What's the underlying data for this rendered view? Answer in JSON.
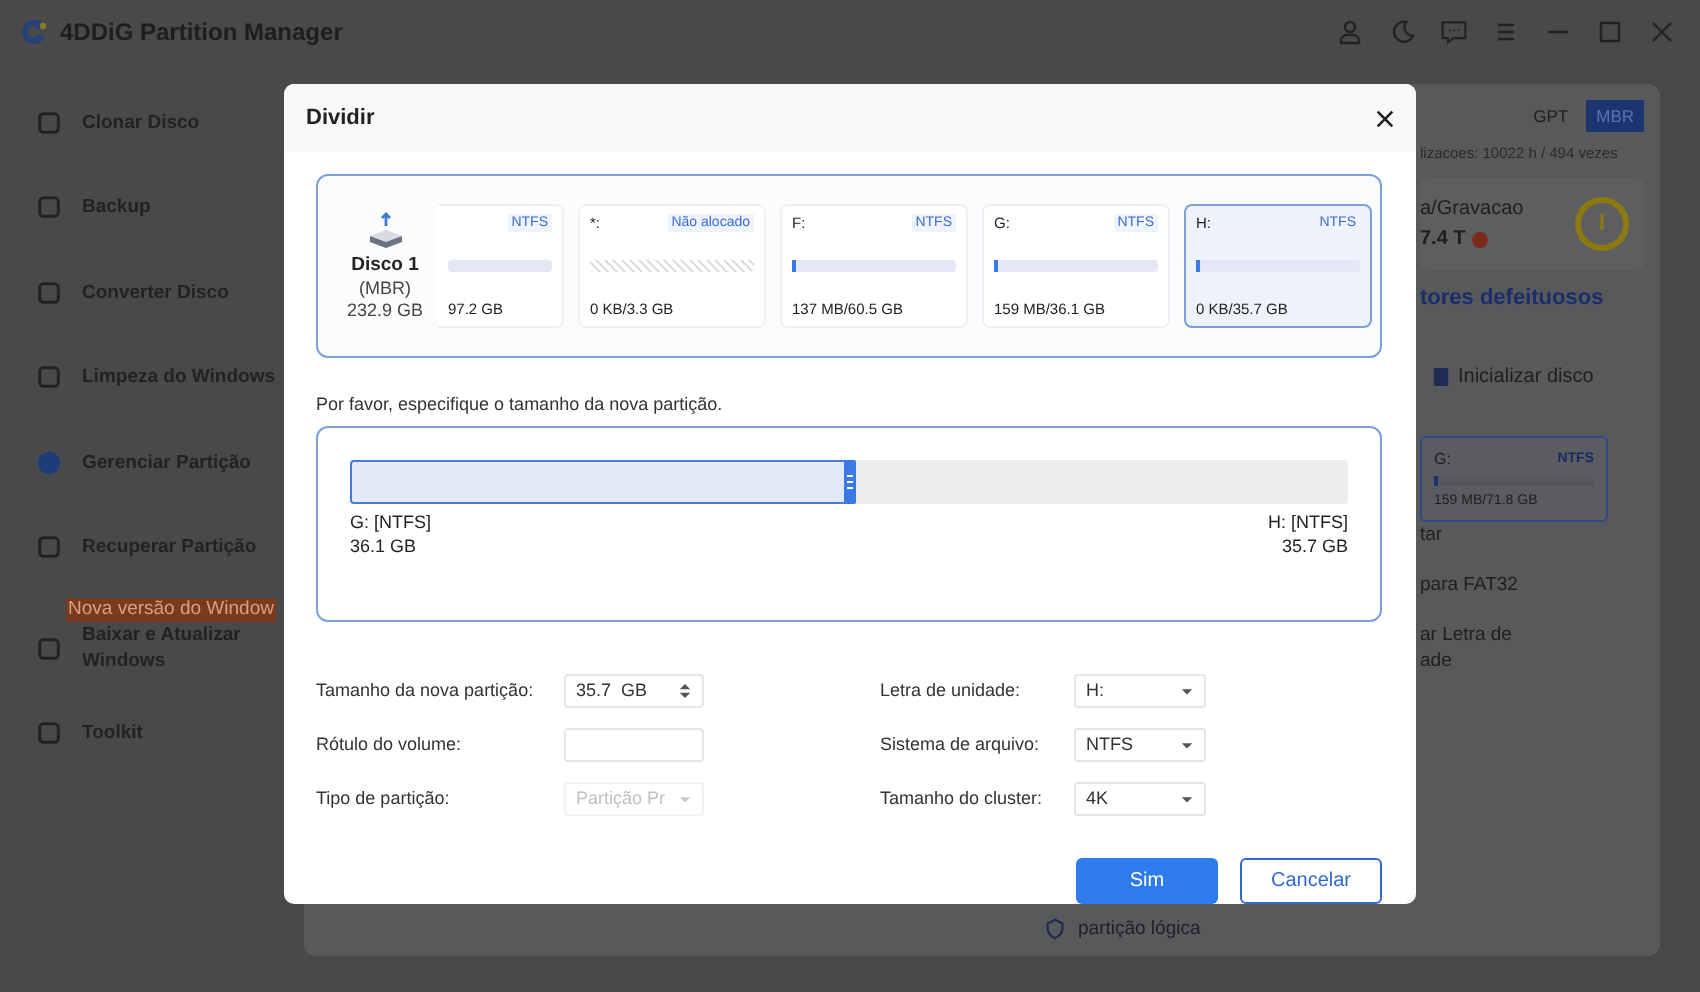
{
  "window": {
    "title": "4DDiG Partition Manager"
  },
  "sidebar": {
    "items": [
      {
        "label": "Clonar Disco",
        "selected": false
      },
      {
        "label": "Backup",
        "selected": false
      },
      {
        "label": "Converter Disco",
        "selected": false
      },
      {
        "label": "Limpeza do Windows",
        "selected": false
      },
      {
        "label": "Gerenciar Partição",
        "selected": true
      },
      {
        "label": "Recuperar Partição",
        "selected": false
      },
      {
        "label": "Baixar e Atualizar Windows",
        "selected": false,
        "badge": "Nova versão do Window"
      },
      {
        "label": "Toolkit",
        "selected": false
      }
    ]
  },
  "background_panel": {
    "style_tabs": [
      {
        "label": "GPT",
        "selected": false
      },
      {
        "label": "MBR",
        "selected": true
      }
    ],
    "usage": "lizacoes: 10022 h / 494 vezes",
    "rw_label": "a/Gravacao",
    "rw_value": "7.4 T",
    "link": "tores defeituosos",
    "init_action": "Inicializar disco",
    "partition": {
      "letter": "G:",
      "fs": "NTFS",
      "usage": "159 MB/71.8 GB",
      "level": 0.02
    },
    "actions": [
      "tar",
      "para FAT32",
      "ar Letra de\nade"
    ],
    "bottom_action": "partição lógica"
  },
  "dialog": {
    "title": "Dividir",
    "disk": {
      "name": "Disco 1",
      "style": "(MBR)",
      "size": "232.9 GB"
    },
    "partitions": [
      {
        "kind": "partition",
        "fs": "NTFS",
        "usage": "97.2 GB",
        "selected": false
      },
      {
        "kind": "unallocated",
        "letter": "*:",
        "fs": "Não alocado",
        "usage": "0 KB/3.3 GB",
        "selected": false
      },
      {
        "kind": "partition",
        "letter": "F:",
        "fs": "NTFS",
        "usage": "137 MB/60.5 GB",
        "level": 0.02,
        "selected": false
      },
      {
        "kind": "partition",
        "letter": "G:",
        "fs": "NTFS",
        "usage": "159 MB/36.1 GB",
        "level": 0.02,
        "selected": false
      },
      {
        "kind": "partition",
        "letter": "H:",
        "fs": "NTFS",
        "usage": "0 KB/35.7 GB",
        "level": 0.02,
        "selected": true
      }
    ],
    "prompt": "Por favor, especifique o tamanho da nova partição.",
    "split": {
      "level": 0.503,
      "left_label": "G: [NTFS]",
      "left_size": "36.1 GB",
      "right_label": "H: [NTFS]",
      "right_size": "35.7 GB"
    },
    "fields_left": [
      {
        "kind": "spinner",
        "label": "Tamanho da nova partição:",
        "value": "35.7  GB",
        "disabled": false
      },
      {
        "kind": "text",
        "label": "Rótulo do volume:",
        "disabled": false
      },
      {
        "kind": "select",
        "label": "Tipo de partição:",
        "value": "Partição Pr",
        "disabled": true
      }
    ],
    "fields_right": [
      {
        "kind": "select",
        "label": "Letra de unidade:",
        "value": "H:",
        "disabled": false
      },
      {
        "kind": "select",
        "label": "Sistema de arquivo:",
        "value": "NTFS",
        "disabled": false
      },
      {
        "kind": "select",
        "label": "Tamanho do cluster:",
        "value": "4K",
        "disabled": false
      }
    ],
    "ok_button": "Sim",
    "cancel_button": "Cancelar"
  }
}
